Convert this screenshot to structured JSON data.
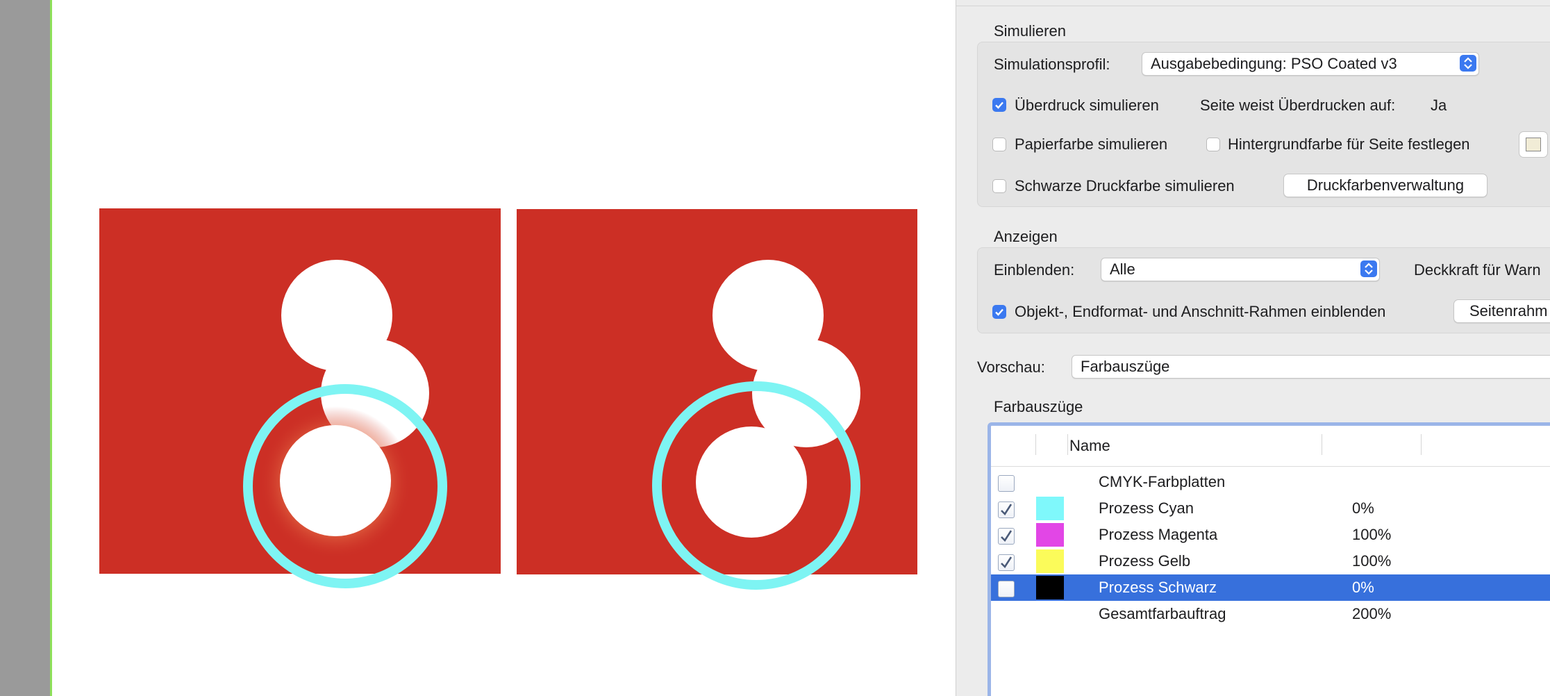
{
  "colors": {
    "artwork_red": "#cc2f25",
    "overprint_ring": "#7ef4f3",
    "accent_blue": "#3b79f0",
    "selection_blue": "#3770dc"
  },
  "panel": {
    "simulate": {
      "heading": "Simulieren",
      "profile_label": "Simulationsprofil:",
      "profile_value": "Ausgabebedingung: PSO Coated v3",
      "overprint_label": "Überdruck simulieren",
      "overprint_checked": true,
      "page_overprint_label": "Seite weist Überdrucken auf:",
      "page_overprint_value": "Ja",
      "paper_color_label": "Papierfarbe simulieren",
      "paper_color_checked": false,
      "bg_color_label": "Hintergrundfarbe für Seite festlegen",
      "bg_color_checked": false,
      "black_ink_label": "Schwarze Druckfarbe simulieren",
      "black_ink_checked": false,
      "ink_manager_button": "Druckfarbenverwaltung"
    },
    "show": {
      "heading": "Anzeigen",
      "show_label": "Einblenden:",
      "show_value": "Alle",
      "opacity_label": "Deckkraft für Warn",
      "frames_label": "Objekt-, Endformat- und Anschnitt-Rahmen einblenden",
      "frames_checked": true,
      "page_frames_button": "Seitenrahm"
    },
    "preview": {
      "label": "Vorschau:",
      "value": "Farbauszüge"
    },
    "separations": {
      "heading": "Farbauszüge",
      "columns": {
        "name": "Name"
      },
      "rows": [
        {
          "name": "CMYK-Farbplatten",
          "percent": "",
          "checked": false,
          "swatch": ""
        },
        {
          "name": "Prozess Cyan",
          "percent": "0%",
          "checked": true,
          "swatch": "#7ff8fb"
        },
        {
          "name": "Prozess Magenta",
          "percent": "100%",
          "checked": true,
          "swatch": "#e246e6"
        },
        {
          "name": "Prozess Gelb",
          "percent": "100%",
          "checked": true,
          "swatch": "#fbfb5a"
        },
        {
          "name": "Prozess Schwarz",
          "percent": "0%",
          "checked": false,
          "swatch": "#000000",
          "selected": true
        },
        {
          "name": "Gesamtfarbauftrag",
          "percent": "200%",
          "checked": null,
          "swatch": ""
        }
      ]
    }
  }
}
